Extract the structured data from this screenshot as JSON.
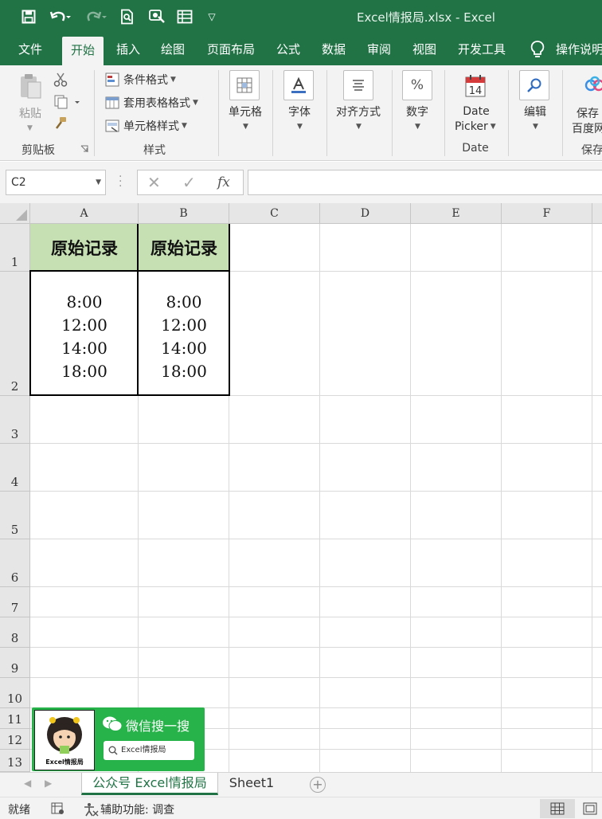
{
  "window": {
    "title": "Excel情报局.xlsx  -  Excel"
  },
  "quick_access": [
    "save-icon",
    "undo-icon",
    "redo-icon",
    "print-preview-icon",
    "touch-mode-icon",
    "form-icon",
    "customize-icon"
  ],
  "tabs": [
    {
      "label": "文件",
      "active": false
    },
    {
      "label": "开始",
      "active": true
    },
    {
      "label": "插入",
      "active": false
    },
    {
      "label": "绘图",
      "active": false
    },
    {
      "label": "页面布局",
      "active": false
    },
    {
      "label": "公式",
      "active": false
    },
    {
      "label": "数据",
      "active": false
    },
    {
      "label": "审阅",
      "active": false
    },
    {
      "label": "视图",
      "active": false
    },
    {
      "label": "开发工具",
      "active": false
    }
  ],
  "tell_me": "操作说明",
  "ribbon": {
    "clipboard": {
      "paste": "粘贴",
      "group": "剪贴板"
    },
    "styles": {
      "conditional": "条件格式",
      "table": "套用表格格式",
      "cell_styles": "单元格样式",
      "group": "样式"
    },
    "cells": {
      "label": "单元格"
    },
    "font": {
      "label": "字体"
    },
    "alignment": {
      "label": "对齐方式"
    },
    "number": {
      "label": "数字"
    },
    "date_picker": {
      "line1": "Date",
      "line2": "Picker",
      "group": "Date",
      "calendar_day": "14"
    },
    "editing": {
      "label": "编辑"
    },
    "save": {
      "line1": "保存",
      "line2": "百度网",
      "group": "保存"
    }
  },
  "formula_bar": {
    "name_box": "C2",
    "fx": "fx",
    "formula": ""
  },
  "grid": {
    "columns": [
      "A",
      "B",
      "C",
      "D",
      "E",
      "F"
    ],
    "selected_column": "C",
    "rows": [
      "1",
      "2",
      "3",
      "4",
      "5",
      "6",
      "7",
      "8",
      "9",
      "10",
      "11",
      "12",
      "13"
    ],
    "cells": {
      "A1": "原始记录",
      "B1": "原始记录",
      "A2": [
        "8:00",
        "12:00",
        "14:00",
        "18:00"
      ],
      "B2": [
        "8:00",
        "12:00",
        "14:00",
        "18:00"
      ]
    },
    "header_fill": "#c6e0b4"
  },
  "promo": {
    "title": "微信搜一搜",
    "search_text": "Excel情报局",
    "avatar_label": "Excel情报局",
    "color": "#27b24a"
  },
  "sheets": [
    {
      "name": "公众号 Excel情报局",
      "active": true
    },
    {
      "name": "Sheet1",
      "active": false
    }
  ],
  "status": {
    "ready": "就绪",
    "accessibility": "辅助功能: 调查"
  },
  "colors": {
    "excel_green": "#217346",
    "accent_selection": "#217346"
  }
}
